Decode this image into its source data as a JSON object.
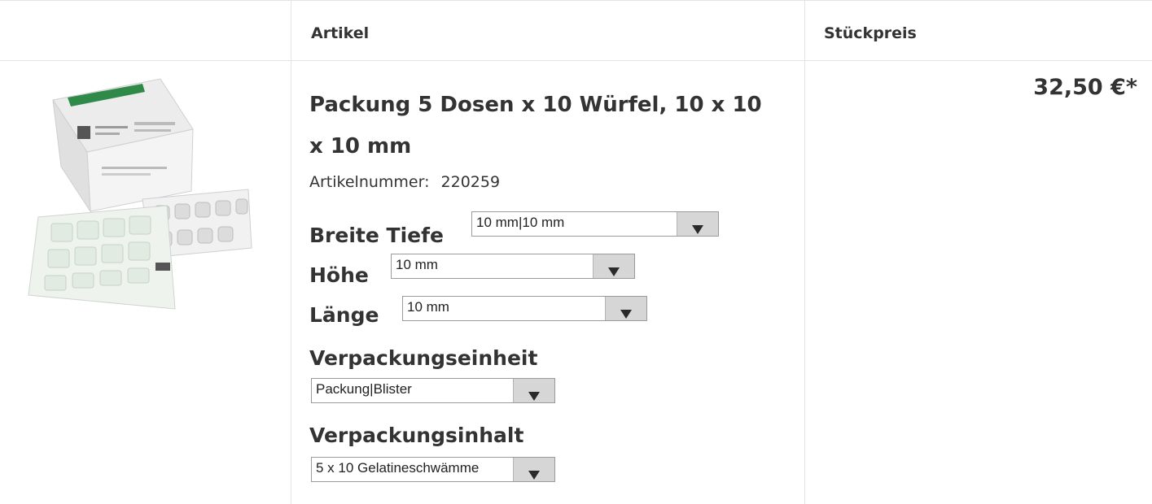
{
  "header": {
    "col_article": "Artikel",
    "col_price": "Stückpreis"
  },
  "product": {
    "title": "Packung 5 Dosen x 10 Würfel, 10 x 10 x 10 mm",
    "article_number_label": "Artikelnummer:",
    "article_number": "220259",
    "price": "32,50 €*",
    "image_alt": "Gelatine-Schwamm-Packung"
  },
  "options": {
    "breite_tiefe": {
      "label": "Breite Tiefe",
      "value": "10 mm|10 mm"
    },
    "hoehe": {
      "label": "Höhe",
      "value": "10 mm"
    },
    "laenge": {
      "label": "Länge",
      "value": "10 mm"
    },
    "verpackungseinheit": {
      "label": "Verpackungseinheit",
      "value": "Packung|Blister"
    },
    "verpackungsinhalt": {
      "label": "Verpackungsinhalt",
      "value": "5 x 10 Gelatineschwämme"
    }
  },
  "icons": {
    "dropdown": "triangle-down-icon"
  }
}
